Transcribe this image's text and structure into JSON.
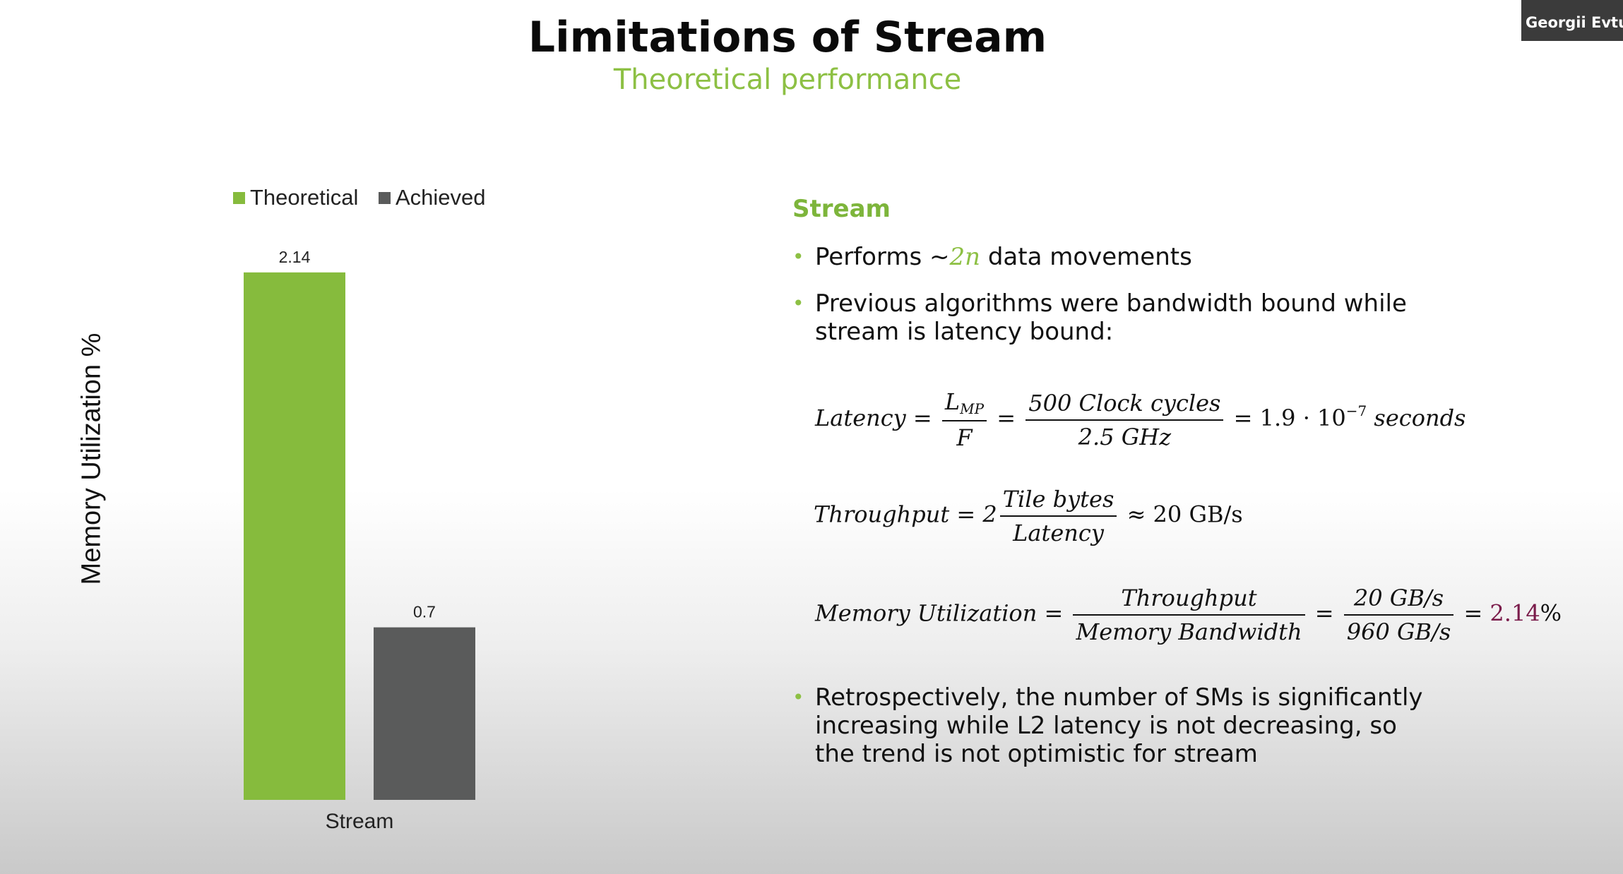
{
  "slide": {
    "title": "Limitations of Stream",
    "subtitle": "Theoretical performance"
  },
  "participant": {
    "name": "Georgii Evtusl"
  },
  "colors": {
    "accent_green": "#8dc044",
    "bar_green": "#86bb3d",
    "bar_gray": "#5a5b5b",
    "highlight": "#7a1b4a"
  },
  "chart_data": {
    "type": "bar",
    "categories": [
      "Stream"
    ],
    "series": [
      {
        "name": "Theoretical",
        "values": [
          2.14
        ],
        "color": "#86bb3d"
      },
      {
        "name": "Achieved",
        "values": [
          0.7
        ],
        "color": "#5a5b5b"
      }
    ],
    "data_labels": [
      "2.14",
      "0.7"
    ],
    "xlabel": "",
    "ylabel": "Memory Utilization %",
    "ylim": [
      0,
      2.3
    ],
    "grid": false,
    "legend_position": "top"
  },
  "panel": {
    "heading": "Stream",
    "bullet1": {
      "pre": "Performs ~",
      "accent": "2n",
      "post": " data movements"
    },
    "bullet2": {
      "line1": "Previous algorithms were bandwidth bound while",
      "line2": "stream is latency bound:"
    },
    "eq1": {
      "lhs": "Latency =",
      "f1_num": "L",
      "f1_num_sub": "MP",
      "f1_den": "F",
      "eq": "=",
      "f2_num": "500 Clock cycles",
      "f2_den": "2.5 GHz",
      "rhs_pre": "= 1.9 · 10",
      "rhs_exp": "−7",
      "rhs_unit": " seconds"
    },
    "eq2": {
      "lhs": "Throughput = 2",
      "f_num": "Tile bytes",
      "f_den": "Latency",
      "rhs": "≈ 20 GB/s"
    },
    "eq3": {
      "lhs": "Memory Utilization =",
      "f1_num": "Throughput",
      "f1_den": "Memory Bandwidth",
      "eq": "=",
      "f2_num": "20 GB/s",
      "f2_den": "960 GB/s",
      "rhs_eq": "=",
      "rhs_val": "2.14",
      "rhs_pct": "%"
    },
    "bullet3": {
      "line1": "Retrospectively, the number of SMs is significantly",
      "line2": "increasing while L2 latency is not decreasing, so",
      "line3": "the trend is not optimistic for stream"
    }
  }
}
